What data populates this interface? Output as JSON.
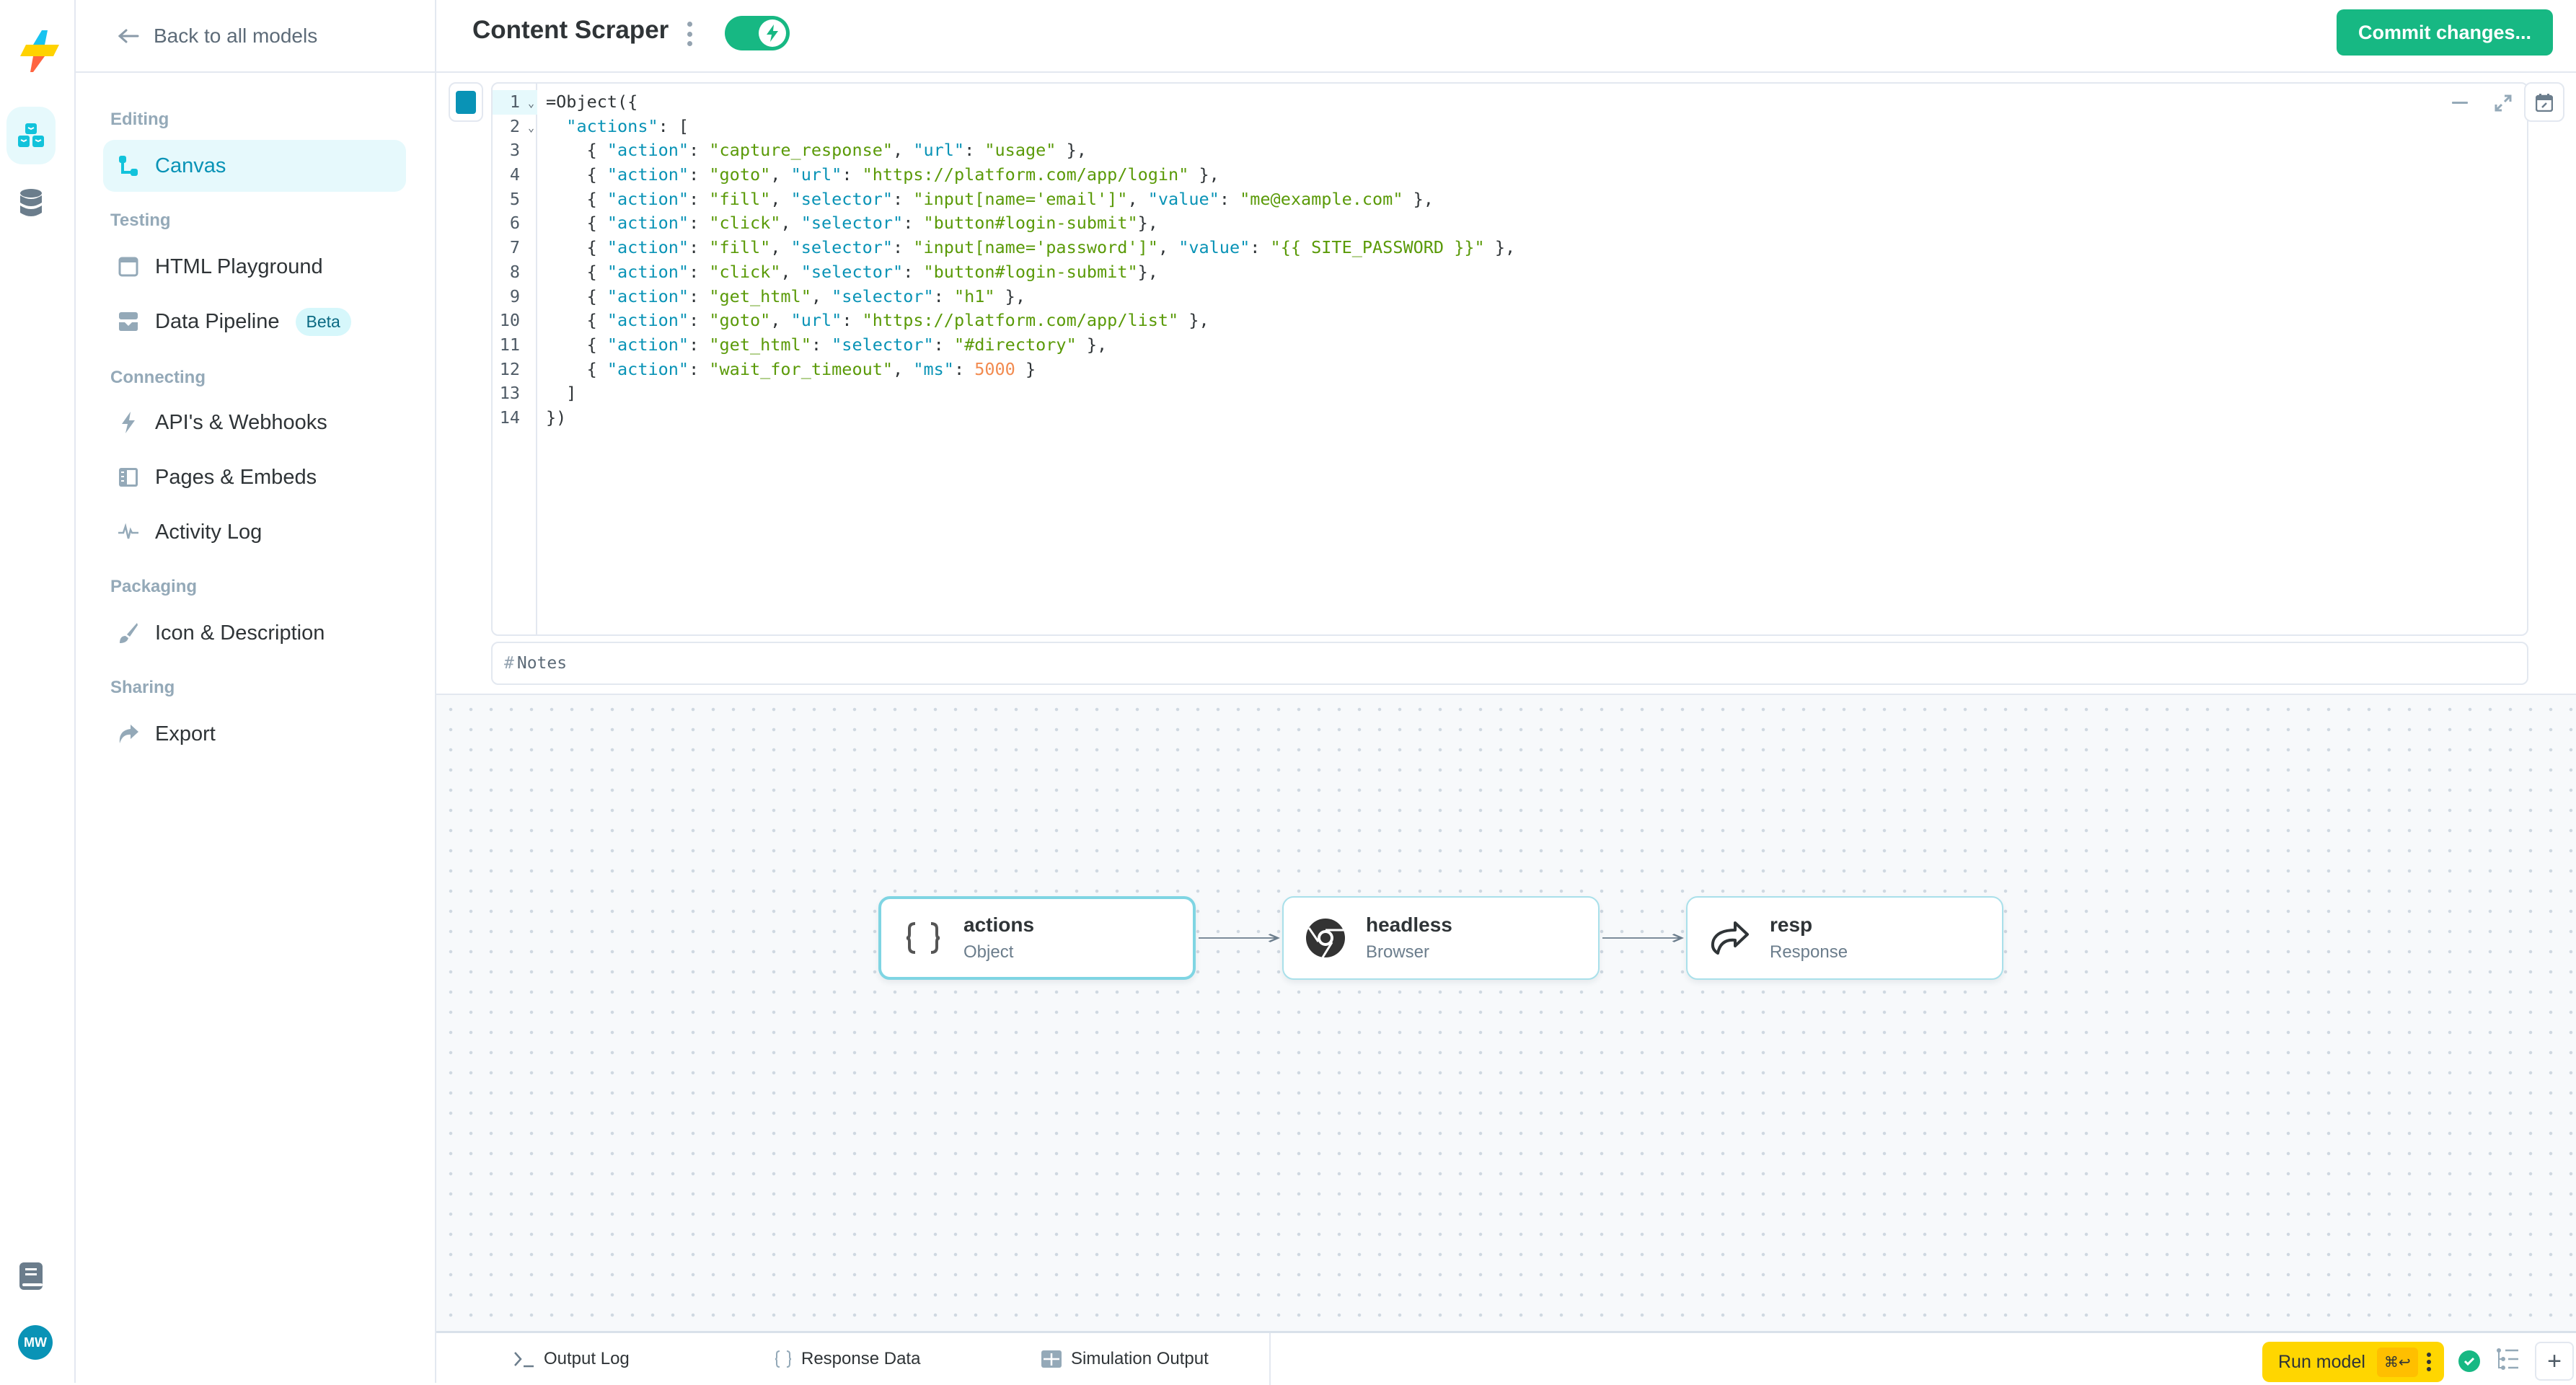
{
  "app": {
    "brand_colors": {
      "accent": "#0993b6",
      "success": "#17b883",
      "run": "#ffd600"
    }
  },
  "rail": {
    "items": [
      {
        "name": "models",
        "icon": "cubes-icon",
        "active": true
      },
      {
        "name": "databases",
        "icon": "database-icon",
        "active": false
      }
    ],
    "docs_icon": "book-icon",
    "avatar_initials": "MW"
  },
  "sidebar": {
    "back_label": "Back to all models",
    "sections": [
      {
        "label": "Editing",
        "items": [
          {
            "label": "Canvas",
            "icon": "flow-icon",
            "active": true
          }
        ]
      },
      {
        "label": "Testing",
        "items": [
          {
            "label": "HTML Playground",
            "icon": "browser-window-icon"
          },
          {
            "label": "Data Pipeline",
            "icon": "inbox-download-icon",
            "badge": "Beta"
          }
        ]
      },
      {
        "label": "Connecting",
        "items": [
          {
            "label": "API's & Webhooks",
            "icon": "bolt-icon"
          },
          {
            "label": "Pages & Embeds",
            "icon": "sidebar-layout-icon"
          },
          {
            "label": "Activity Log",
            "icon": "pulse-icon"
          }
        ]
      },
      {
        "label": "Packaging",
        "items": [
          {
            "label": "Icon & Description",
            "icon": "paintbrush-icon"
          }
        ]
      },
      {
        "label": "Sharing",
        "items": [
          {
            "label": "Export",
            "icon": "share-arrow-icon"
          }
        ]
      }
    ]
  },
  "header": {
    "title": "Content Scraper",
    "toggle_on": true,
    "commit_label": "Commit changes..."
  },
  "editor": {
    "lines": [
      [
        [
          "t",
          "=Object({"
        ]
      ],
      [
        [
          "t",
          "  "
        ],
        [
          "k",
          "\"actions\""
        ],
        [
          "t",
          ": ["
        ]
      ],
      [
        [
          "t",
          "    { "
        ],
        [
          "k",
          "\"action\""
        ],
        [
          "t",
          ": "
        ],
        [
          "s",
          "\"capture_response\""
        ],
        [
          "t",
          ", "
        ],
        [
          "k",
          "\"url\""
        ],
        [
          "t",
          ": "
        ],
        [
          "s",
          "\"usage\""
        ],
        [
          "t",
          " },"
        ]
      ],
      [
        [
          "t",
          "    { "
        ],
        [
          "k",
          "\"action\""
        ],
        [
          "t",
          ": "
        ],
        [
          "s",
          "\"goto\""
        ],
        [
          "t",
          ", "
        ],
        [
          "k",
          "\"url\""
        ],
        [
          "t",
          ": "
        ],
        [
          "s",
          "\"https://platform.com/app/login\""
        ],
        [
          "t",
          " },"
        ]
      ],
      [
        [
          "t",
          "    { "
        ],
        [
          "k",
          "\"action\""
        ],
        [
          "t",
          ": "
        ],
        [
          "s",
          "\"fill\""
        ],
        [
          "t",
          ", "
        ],
        [
          "k",
          "\"selector\""
        ],
        [
          "t",
          ": "
        ],
        [
          "s",
          "\"input[name='email']\""
        ],
        [
          "t",
          ", "
        ],
        [
          "k",
          "\"value\""
        ],
        [
          "t",
          ": "
        ],
        [
          "s",
          "\"me@example.com\""
        ],
        [
          "t",
          " },"
        ]
      ],
      [
        [
          "t",
          "    { "
        ],
        [
          "k",
          "\"action\""
        ],
        [
          "t",
          ": "
        ],
        [
          "s",
          "\"click\""
        ],
        [
          "t",
          ", "
        ],
        [
          "k",
          "\"selector\""
        ],
        [
          "t",
          ": "
        ],
        [
          "s",
          "\"button#login-submit\""
        ],
        [
          "t",
          "},"
        ]
      ],
      [
        [
          "t",
          "    { "
        ],
        [
          "k",
          "\"action\""
        ],
        [
          "t",
          ": "
        ],
        [
          "s",
          "\"fill\""
        ],
        [
          "t",
          ", "
        ],
        [
          "k",
          "\"selector\""
        ],
        [
          "t",
          ": "
        ],
        [
          "s",
          "\"input[name='password']\""
        ],
        [
          "t",
          ", "
        ],
        [
          "k",
          "\"value\""
        ],
        [
          "t",
          ": "
        ],
        [
          "s",
          "\"{{ SITE_PASSWORD }}\""
        ],
        [
          "t",
          " },"
        ]
      ],
      [
        [
          "t",
          "    { "
        ],
        [
          "k",
          "\"action\""
        ],
        [
          "t",
          ": "
        ],
        [
          "s",
          "\"click\""
        ],
        [
          "t",
          ", "
        ],
        [
          "k",
          "\"selector\""
        ],
        [
          "t",
          ": "
        ],
        [
          "s",
          "\"button#login-submit\""
        ],
        [
          "t",
          "},"
        ]
      ],
      [
        [
          "t",
          "    { "
        ],
        [
          "k",
          "\"action\""
        ],
        [
          "t",
          ": "
        ],
        [
          "s",
          "\"get_html\""
        ],
        [
          "t",
          ", "
        ],
        [
          "k",
          "\"selector\""
        ],
        [
          "t",
          ": "
        ],
        [
          "s",
          "\"h1\""
        ],
        [
          "t",
          " },"
        ]
      ],
      [
        [
          "t",
          "    { "
        ],
        [
          "k",
          "\"action\""
        ],
        [
          "t",
          ": "
        ],
        [
          "s",
          "\"goto\""
        ],
        [
          "t",
          ", "
        ],
        [
          "k",
          "\"url\""
        ],
        [
          "t",
          ": "
        ],
        [
          "s",
          "\"https://platform.com/app/list\""
        ],
        [
          "t",
          " },"
        ]
      ],
      [
        [
          "t",
          "    { "
        ],
        [
          "k",
          "\"action\""
        ],
        [
          "t",
          ": "
        ],
        [
          "s",
          "\"get_html\""
        ],
        [
          "t",
          ": "
        ],
        [
          "k",
          "\"selector\""
        ],
        [
          "t",
          ": "
        ],
        [
          "s",
          "\"#directory\""
        ],
        [
          "t",
          " },"
        ]
      ],
      [
        [
          "t",
          "    { "
        ],
        [
          "k",
          "\"action\""
        ],
        [
          "t",
          ": "
        ],
        [
          "s",
          "\"wait_for_timeout\""
        ],
        [
          "t",
          ", "
        ],
        [
          "k",
          "\"ms\""
        ],
        [
          "t",
          ": "
        ],
        [
          "n",
          "5000"
        ],
        [
          "t",
          " }"
        ]
      ],
      [
        [
          "t",
          "  ]"
        ]
      ],
      [
        [
          "t",
          "})"
        ]
      ]
    ],
    "foldable_lines": [
      1,
      2
    ],
    "current_line": 1,
    "notes_prefix": "#",
    "notes_placeholder": "Notes"
  },
  "canvas": {
    "nodes": [
      {
        "name": "actions",
        "type": "Object",
        "icon": "braces-icon",
        "selected": true
      },
      {
        "name": "headless",
        "type": "Browser",
        "icon": "chrome-icon",
        "selected": false
      },
      {
        "name": "resp",
        "type": "Response",
        "icon": "reply-arrow-icon",
        "selected": false
      }
    ],
    "edges": [
      [
        "actions",
        "headless"
      ],
      [
        "headless",
        "resp"
      ]
    ]
  },
  "bottom_bar": {
    "tabs": [
      {
        "label": "Output Log",
        "icon": "terminal-icon"
      },
      {
        "label": "Response Data",
        "icon": "braces-icon"
      },
      {
        "label": "Simulation Output",
        "icon": "table-icon"
      }
    ],
    "run_label": "Run model",
    "run_shortcut": "⌘↩",
    "status": "success",
    "add_label": "+"
  }
}
